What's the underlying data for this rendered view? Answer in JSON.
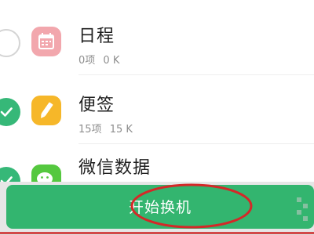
{
  "items": [
    {
      "name": "日程",
      "count": "0项",
      "size": "0 K",
      "checked": false,
      "icon": "calendar-icon",
      "icon_color": "#f2a7ad"
    },
    {
      "name": "便签",
      "count": "15项",
      "size": "15 K",
      "checked": true,
      "icon": "note-pencil-icon",
      "icon_color": "#f6b729"
    },
    {
      "name": "微信数据",
      "count": "",
      "size": "",
      "checked": true,
      "icon": "wechat-icon",
      "icon_color": "#55c83f"
    }
  ],
  "start_button": {
    "label": "开始换机"
  },
  "colors": {
    "accent_green": "#33b56f",
    "check_green": "#36b878",
    "annotation_red": "#d42828"
  }
}
